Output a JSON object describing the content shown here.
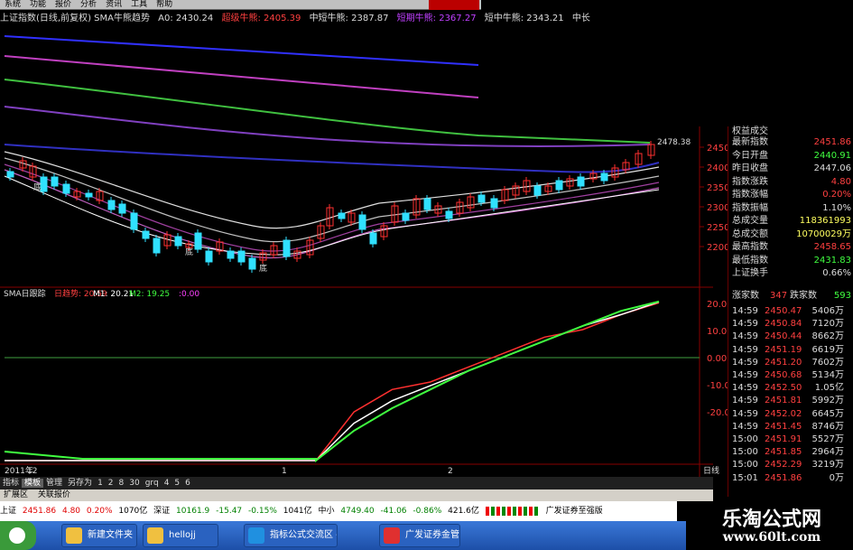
{
  "menu": {
    "items": [
      "系统",
      "功能",
      "报价",
      "分析",
      "资讯",
      "工具",
      "帮助"
    ],
    "extra": "最新期货"
  },
  "infoline": {
    "title": "上证指数(日线,前复权) SMA牛熊趋势",
    "a0": "A0: 2430.24",
    "super": "超级牛熊: 2405.39",
    "mid": "中短牛熊: 2387.87",
    "short": "短期牛熊: 2367.27",
    "mid2": "短中牛熊: 2343.21",
    "mid3": "中长"
  },
  "indicator": {
    "name": "SMA日跟踪",
    "daily": "日趋势: 20.59",
    "m1": "M1: 20.21",
    "m2": "M2: 19.25",
    "zero": ":0.00"
  },
  "price_axis": {
    "ticks": [
      "2450",
      "2400",
      "2350",
      "2300",
      "2250",
      "2200"
    ],
    "high_label": "2478.38",
    "low_marks": [
      "底",
      "底",
      "底"
    ]
  },
  "ind_axis": {
    "ticks": [
      "20.00",
      "10.00",
      "0.00",
      "-10.00",
      "-20.00"
    ]
  },
  "time_axis": {
    "labels": [
      "2011年",
      "12",
      "1",
      "2"
    ],
    "period": "日线"
  },
  "panel": {
    "header": "权益成交",
    "rows": [
      {
        "label": "最新指数",
        "value": "2451.86",
        "color": "#ff4040"
      },
      {
        "label": "今日开盘",
        "value": "2440.91",
        "color": "#40ff40"
      },
      {
        "label": "昨日收盘",
        "value": "2447.06",
        "color": "#dddddd"
      },
      {
        "label": "指数涨跌",
        "value": "4.80",
        "color": "#ff4040"
      },
      {
        "label": "指数涨幅",
        "value": "0.20%",
        "color": "#ff4040"
      },
      {
        "label": "指数振幅",
        "value": "1.10%",
        "color": "#dddddd"
      },
      {
        "label": "总成交量",
        "value": "118361993",
        "color": "#ffff60"
      },
      {
        "label": "总成交额",
        "value": "10700029万",
        "color": "#ffff60"
      },
      {
        "label": "最高指数",
        "value": "2458.65",
        "color": "#ff4040"
      },
      {
        "label": "最低指数",
        "value": "2431.83",
        "color": "#40ff40"
      },
      {
        "label": "上证换手",
        "value": "0.66%",
        "color": "#dddddd"
      }
    ],
    "updown": {
      "up_label": "涨家数",
      "up": "347",
      "down_label": "跌家数",
      "down": "593"
    },
    "ticks": [
      {
        "t": "14:59",
        "p": "2450.47",
        "v": "5406万"
      },
      {
        "t": "14:59",
        "p": "2450.84",
        "v": "7120万"
      },
      {
        "t": "14:59",
        "p": "2450.44",
        "v": "8662万"
      },
      {
        "t": "14:59",
        "p": "2451.19",
        "v": "6619万"
      },
      {
        "t": "14:59",
        "p": "2451.20",
        "v": "7602万"
      },
      {
        "t": "14:59",
        "p": "2450.68",
        "v": "5134万"
      },
      {
        "t": "14:59",
        "p": "2452.50",
        "v": "1.05亿"
      },
      {
        "t": "14:59",
        "p": "2451.81",
        "v": "5992万"
      },
      {
        "t": "14:59",
        "p": "2452.02",
        "v": "6645万"
      },
      {
        "t": "14:59",
        "p": "2451.45",
        "v": "8746万"
      },
      {
        "t": "15:00",
        "p": "2451.91",
        "v": "5527万"
      },
      {
        "t": "15:00",
        "p": "2451.85",
        "v": "2964万"
      },
      {
        "t": "15:00",
        "p": "2452.29",
        "v": "3219万"
      },
      {
        "t": "15:01",
        "p": "2451.86",
        "v": "0万"
      }
    ]
  },
  "tabs": [
    "指标",
    "模板",
    "管理",
    "另存为",
    "1",
    "2",
    "8",
    "30",
    "grq",
    "4",
    "5",
    "6"
  ],
  "ext": [
    "扩展区",
    "关联报价"
  ],
  "status": {
    "sh_label": "上证",
    "sh": "2451.86",
    "sh_chg": "4.80",
    "sh_pct": "0.20%",
    "sh_vol": "1070亿",
    "sz_label": "深证",
    "sz": "10161.9",
    "sz_chg": "-15.47",
    "sz_pct": "-0.15%",
    "sz_vol": "1041亿",
    "zx_label": "中小",
    "zx": "4749.40",
    "zx_chg": "-41.06",
    "zx_pct": "-0.86%",
    "zx_vol": "421.6亿",
    "broker": "广发证券至强版"
  },
  "taskbar": {
    "items": [
      "新建文件夹",
      "hellojj",
      "指标公式交流区 - ...",
      "广发证券金管家..."
    ]
  },
  "watermark": {
    "title": "乐淘公式网",
    "url": "www.60lt.com"
  },
  "colors": {
    "up": "#ff3030",
    "down": "#30e0ff",
    "green_line": "#40c040",
    "purple_line": "#c040c0",
    "blue_line": "#3030ff",
    "red_step": "#ff3030"
  },
  "chart_data": {
    "type": "line",
    "series": [
      {
        "name": "SMA日跟踪",
        "values": [
          0,
          0,
          0,
          0,
          0,
          -0.5,
          6,
          9,
          10,
          12,
          14,
          16,
          17,
          19,
          20.59
        ]
      },
      {
        "name": "M1",
        "values": [
          0,
          0,
          0,
          0,
          0,
          -1,
          4,
          7,
          9,
          11,
          13,
          15,
          17,
          18.5,
          20.21
        ]
      },
      {
        "name": "M2",
        "values": [
          0,
          0,
          0,
          0,
          0,
          -2,
          2,
          5,
          7.5,
          10,
          12,
          14,
          16,
          18,
          19.25
        ]
      }
    ],
    "ylim": [
      -25,
      22
    ]
  }
}
